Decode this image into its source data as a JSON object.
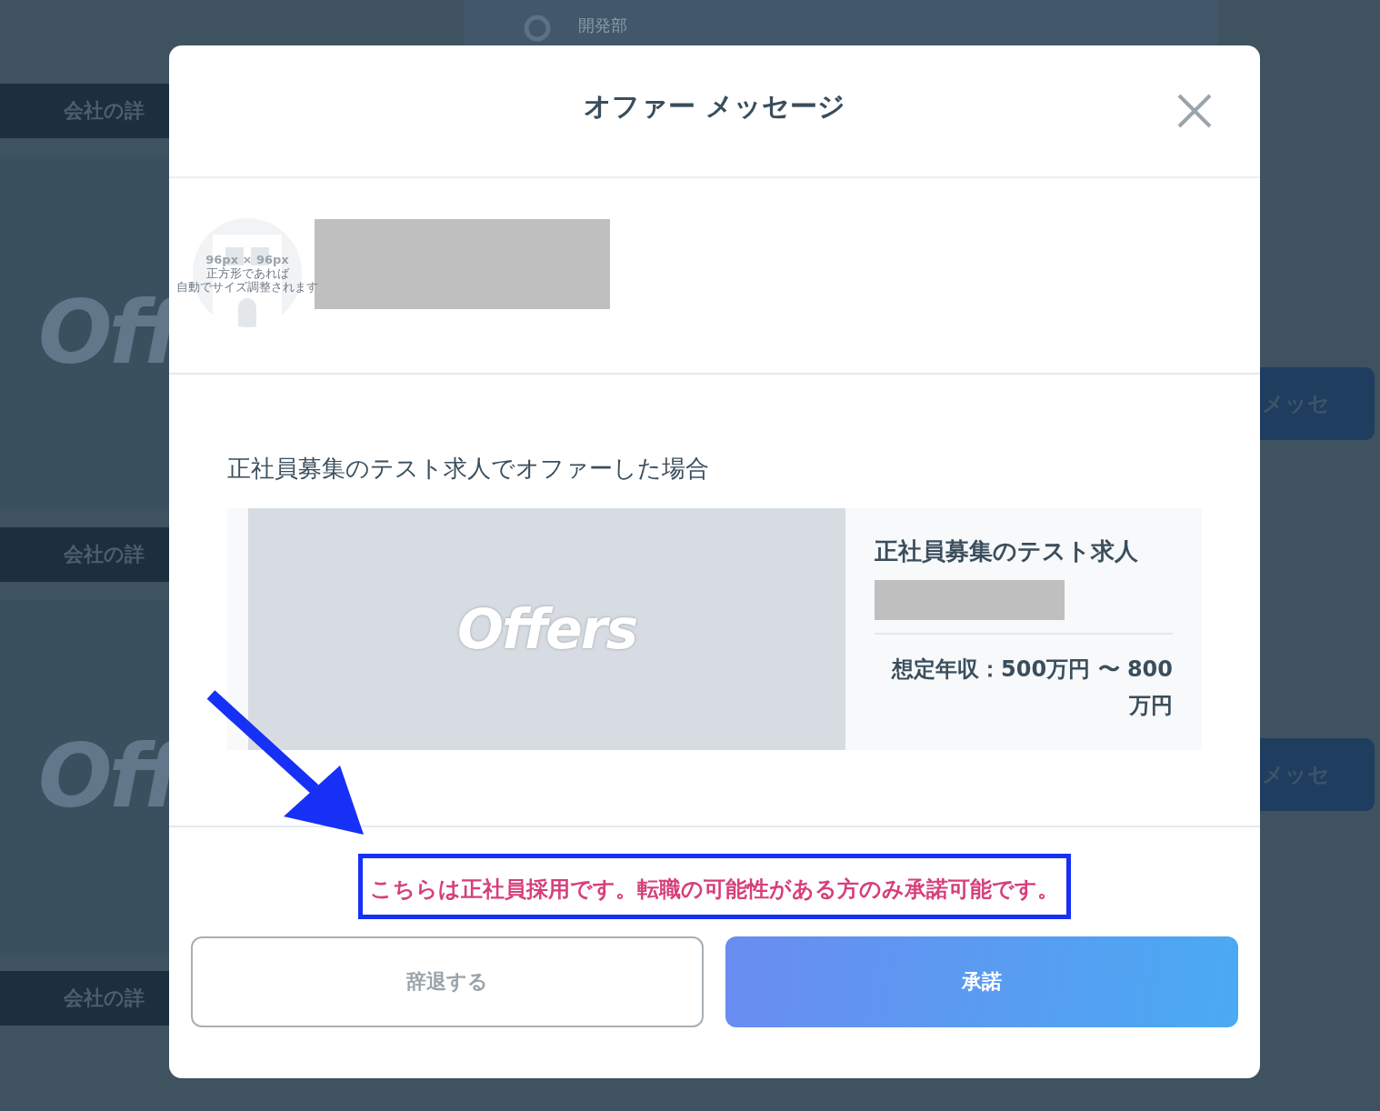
{
  "background": {
    "department": "開発部",
    "company_detail_buttons": [
      "会社の詳",
      "会社の詳",
      "会社の詳"
    ],
    "logo_texts": [
      "Off",
      "Off"
    ],
    "message_buttons": [
      "メッセ",
      "メッセ"
    ]
  },
  "modal": {
    "title": "オファー メッセージ",
    "avatar": {
      "size_label": "96px × 96px",
      "note_lines": [
        "正方形であれば",
        "自動でサイズ調整されます"
      ]
    },
    "intro": "正社員募集のテスト求人でオファーした場合",
    "job": {
      "image_logo": "Offers",
      "title": "正社員募集のテスト求人",
      "salary": "想定年収：500万円 〜 800万円"
    },
    "notice": "こちらは正社員採用です。転職の可能性がある方のみ承諾可能です。",
    "buttons": [
      {
        "label": "辞退する",
        "kind": "secondary"
      },
      {
        "label": "承諾",
        "kind": "primary"
      }
    ]
  }
}
